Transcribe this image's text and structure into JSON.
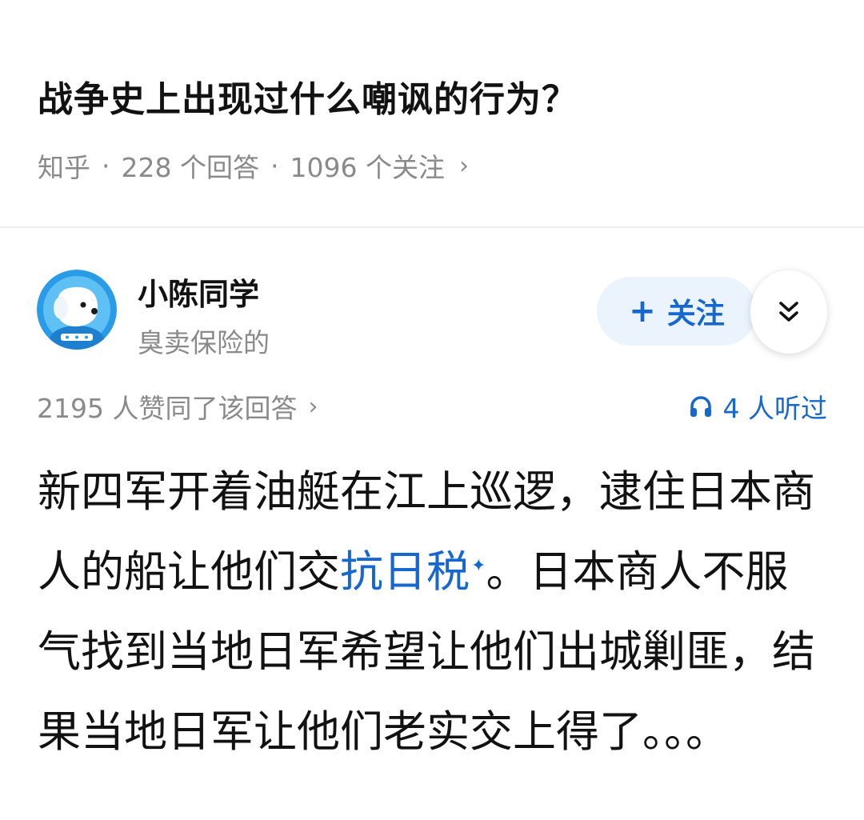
{
  "question": {
    "title": "战争史上出现过什么嘲讽的行为？",
    "source": "知乎",
    "answers": "228 个回答",
    "followers": "1096 个关注"
  },
  "author": {
    "name": "小陈同学",
    "bio": "臭卖保险的",
    "follow_label": "关注"
  },
  "stats": {
    "votes": "2195 人赞同了该回答",
    "listened": "4 人听过"
  },
  "answer": {
    "text_before": "新四军开着油艇在江上巡逻，逮住日本商人的船让他们交",
    "link_text": "抗日税",
    "text_after": "。日本商人不服气找到当地日军希望让他们出城剿匪，结果当地日军让他们老实交上得了。。。"
  },
  "colors": {
    "link": "#1767d1",
    "follow_bg": "#ebf4fd",
    "muted": "#8a8a8a"
  },
  "icons": {
    "more": "double-chevron-down-icon",
    "listen": "headphones-icon",
    "link_mark": "sparkle-icon"
  }
}
